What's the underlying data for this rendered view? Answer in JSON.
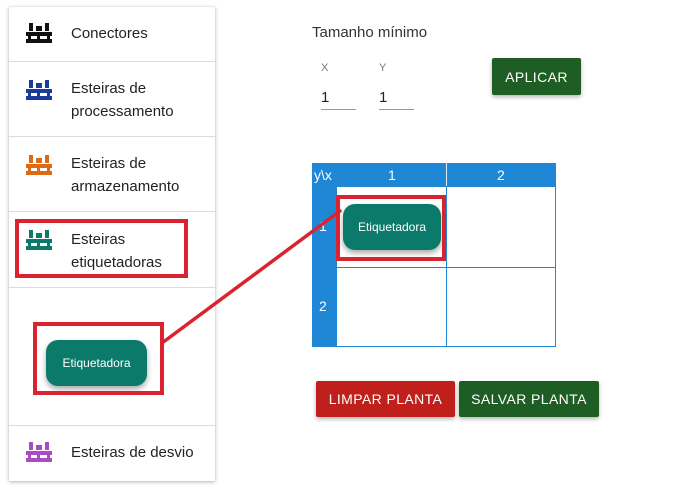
{
  "sidebar": {
    "items": [
      {
        "id": "conectores",
        "label": "Conectores",
        "icon": "conveyor-icon",
        "color": "#111111"
      },
      {
        "id": "processamento",
        "label": "Esteiras de processamento",
        "label_lines": [
          "Esteiras de",
          "processamento"
        ],
        "icon": "conveyor-icon",
        "color": "#1a3a9c"
      },
      {
        "id": "armazenamento",
        "label": "Esteiras de armazenamento",
        "label_lines": [
          "Esteiras de",
          "armazenamento"
        ],
        "icon": "conveyor-icon",
        "color": "#e06a14"
      },
      {
        "id": "etiquetadoras",
        "label": "Esteiras etiquetadoras",
        "label_lines": [
          "Esteiras",
          "etiquetadoras"
        ],
        "icon": "conveyor-icon",
        "color": "#0b7a6a"
      },
      {
        "id": "desvio",
        "label": "Esteiras de desvio",
        "icon": "conveyor-icon",
        "color": "#a84bc4"
      }
    ],
    "draggable_chip": {
      "label": "Etiquetadora",
      "color": "#0b7a6a"
    }
  },
  "settings": {
    "title": "Tamanho mínimo",
    "x": {
      "label": "X",
      "value": "1"
    },
    "y": {
      "label": "Y",
      "value": "1"
    },
    "apply_label": "APLICAR"
  },
  "grid": {
    "corner_label": "y\\x",
    "columns": [
      "1",
      "2"
    ],
    "rows": [
      "1",
      "2"
    ],
    "placed_item": {
      "label": "Etiquetadora",
      "row": 1,
      "col": 1,
      "color": "#0b7a6a"
    },
    "header_color": "#1e87d6"
  },
  "actions": {
    "clear_label": "LIMPAR PLANTA",
    "save_label": "SALVAR PLANTA"
  },
  "annotation_color": "#d9242f"
}
